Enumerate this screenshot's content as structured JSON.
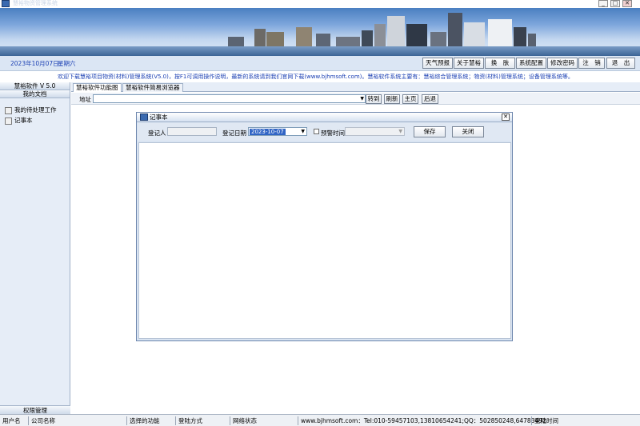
{
  "window": {
    "title": "慧裕物资管理系统",
    "min_glyph": "_",
    "max_glyph": "□",
    "close_glyph": "✕"
  },
  "colors": {
    "accent_blue": "#1a3fb3",
    "selection": "#3165c5"
  },
  "header": {
    "date": "2023年10月07日",
    "weekday": "星期六",
    "buttons": [
      "天气预报",
      "关于慧裕",
      "换　肤",
      "系统配置",
      "修改密码",
      "注　销",
      "退　出"
    ]
  },
  "marquee": "欢迎下载慧裕项目物资(材料)管理系统(V5.0)，按F1可调用操作说明，最新的系统请到我们官网下载(www.bjhmsoft.com)。慧裕软件系统主要有：慧裕综合管理系统；物资(材料)管理系统；设备管理系统等。",
  "sidebar": {
    "version": "慧裕软件 V 5.0",
    "section": "我的文档",
    "items": [
      "我的待处理工作",
      "记事本"
    ],
    "footer": "权限管理"
  },
  "tabs": [
    "慧裕软件功能图",
    "慧裕软件简易浏览器"
  ],
  "browser": {
    "address_label": "地址",
    "address_value": "",
    "dropdown_glyph": "▼",
    "buttons": [
      "转到",
      "刷新",
      "主页",
      "后退"
    ]
  },
  "dialog": {
    "title": "记事本",
    "close_glyph": "✕",
    "recorder_label": "登记人",
    "recorder_value": "",
    "date_label": "登记日期",
    "date_value": "2023-10-07",
    "dropdown_glyph": "▼",
    "alert_label": "预警时间",
    "save": "保存",
    "close": "关闭"
  },
  "statusbar": [
    "用户名",
    "公司名称",
    "选择的功能",
    "登陆方式",
    "网络状态",
    "www.bjhmsoft.com：Tel:010-59457103,13810654241;QQ：502850248,64783492",
    "登陆时间"
  ]
}
